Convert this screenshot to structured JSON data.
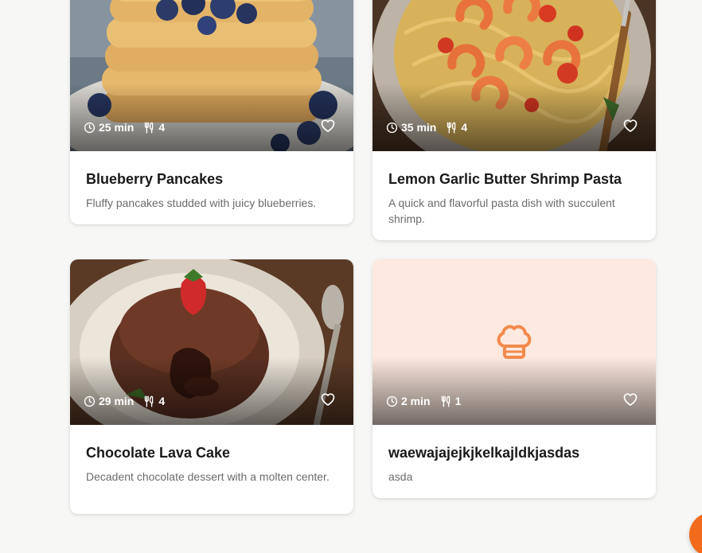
{
  "recipes": [
    {
      "title": "Blueberry Pancakes",
      "description": "Fluffy pancakes studded with juicy blueberries.",
      "time": "25 min",
      "servings": "4",
      "image": "blueberry-pancakes-photo"
    },
    {
      "title": "Lemon Garlic Butter Shrimp Pasta",
      "description": "A quick and flavorful pasta dish with succulent shrimp.",
      "time": "35 min",
      "servings": "4",
      "image": "shrimp-pasta-photo"
    },
    {
      "title": "Chocolate Lava Cake",
      "description": "Decadent chocolate dessert with a molten center.",
      "time": "29 min",
      "servings": "4",
      "image": "chocolate-lava-cake-photo"
    },
    {
      "title": "waewajajejkjkelkajldkjasdas",
      "description": "asda",
      "time": "2 min",
      "servings": "1",
      "image": "chef-hat-placeholder-icon"
    }
  ],
  "icons": {
    "time": "clock-icon",
    "servings": "utensils-icon",
    "favorite": "heart-outline-icon",
    "placeholder": "chef-hat-icon"
  },
  "colors": {
    "accent": "#f26a1b",
    "placeholder_bg": "#fde9df",
    "placeholder_icon": "#f28a4c",
    "title": "#1a1a1a",
    "description": "#6b6b6b"
  }
}
